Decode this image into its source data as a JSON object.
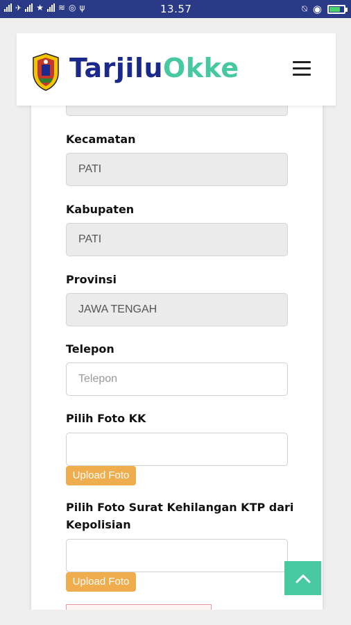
{
  "status_bar": {
    "time": "13.57",
    "battery_color": "#4ad36b"
  },
  "header": {
    "brand_part1": "Tarjilu",
    "brand_part2": "Okke",
    "brand_colors": {
      "part1": "#1b2a8a",
      "part2": "#46c9a0"
    },
    "menu_icon": "hamburger-icon"
  },
  "form": {
    "kecamatan": {
      "label": "Kecamatan",
      "value": "PATI"
    },
    "kabupaten": {
      "label": "Kabupaten",
      "value": "PATI"
    },
    "provinsi": {
      "label": "Provinsi",
      "value": "JAWA TENGAH"
    },
    "telepon": {
      "label": "Telepon",
      "value": "",
      "placeholder": "Telepon"
    },
    "foto_kk": {
      "label": "Pilih Foto KK",
      "upload_label": "Upload Foto"
    },
    "foto_kehilangan": {
      "label_line1": "Pilih Foto Surat Kehilangan KTP dari",
      "label_line2": "Kepolisian",
      "upload_label": "Upload Foto"
    }
  },
  "colors": {
    "accent_teal": "#48c9a1",
    "upload_orange": "#f0ad4e",
    "status_bar_bg": "#2b3a86"
  },
  "scroll_top_icon": "chevron-up-icon"
}
